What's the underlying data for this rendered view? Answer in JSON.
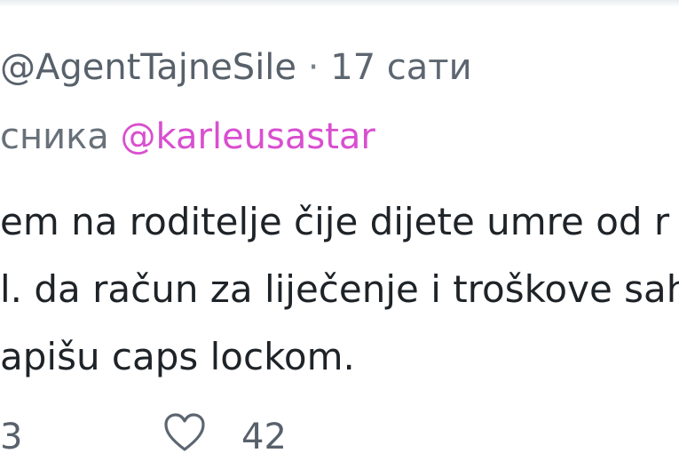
{
  "tweet": {
    "handle": "@AgentTajneSile",
    "separator": "·",
    "time": "17 сати",
    "reply_prefix": "сника",
    "reply_mention": "@karleusastar",
    "lines": [
      "em na roditelje čije dijete umre od r",
      "l. da račun za liječenje i troškove sah",
      "apišu caps lockom."
    ],
    "reply_count": "3",
    "like_count": "42"
  },
  "icons": {
    "like": "heart-icon"
  },
  "colors": {
    "mention": "#d94fd0",
    "muted": "#5d6670",
    "text": "#1e2328"
  }
}
